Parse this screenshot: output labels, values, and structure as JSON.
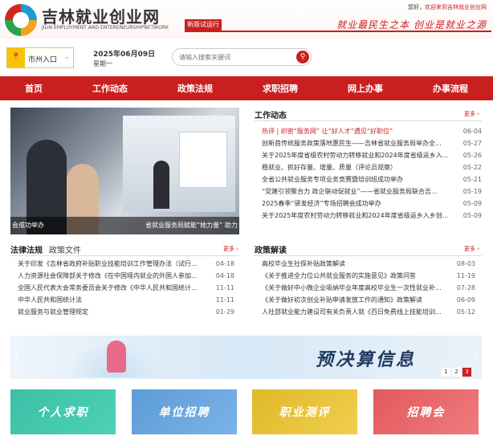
{
  "header": {
    "site_name": "吉林就业创业网",
    "site_name_en": "JILIN EMPLOYMENT AND ENTERENEURSHIPNETWORK",
    "badge": "新版试运行",
    "greeting_prefix": "您好，",
    "greeting_text": "欢迎来到吉林就业创业网",
    "slogan": "就业最民生之本  创业是就业之源"
  },
  "toolbar": {
    "city_label": "市州入口",
    "date": "2025年06月09日",
    "weekday": "星期一",
    "search_placeholder": "请输入搜索关键词"
  },
  "nav": [
    "首页",
    "工作动态",
    "政策法规",
    "求职招聘",
    "网上办事",
    "办事流程"
  ],
  "slider": {
    "caption_left": "会成功举办",
    "caption_right": "省就业服务局赋能“她力量” 助力"
  },
  "work_news": {
    "title": "工作动态",
    "more": "更多 ›",
    "items": [
      {
        "title": "热评 | 织密“服务网” 让“好人才”遇见“好职位”",
        "date": "06-04",
        "highlight": true
      },
      {
        "title": "创新首传统服务政策落地惠民生——吉林省就业服务局举办全...",
        "date": "05-27"
      },
      {
        "title": "关于2025年度省级农村劳动力转移就业和2024年度省级返乡入...",
        "date": "05-26"
      },
      {
        "title": "稳就业、抓好存量、增量、质量（评论员观察）",
        "date": "05-22"
      },
      {
        "title": "全省公共就业服务专项业务竞赛暨培训班成功举办",
        "date": "05-21"
      },
      {
        "title": "“党建引领聚合力 政企联动促就业”——省就业服务局联合吉...",
        "date": "05-19"
      },
      {
        "title": "2025春季“驿发经济”专场招聘会成功举办",
        "date": "05-09"
      },
      {
        "title": "关于2025年度农村劳动力转移就业和2024年度省级返乡入乡创...",
        "date": "05-09"
      }
    ]
  },
  "laws": {
    "tab_active": "法律法规",
    "tab_inactive": "政策文件",
    "more": "更多 ›",
    "items": [
      {
        "title": "关于印发《吉林省政府补贴职业技能培训工作管理办法（试行...",
        "date": "04-18"
      },
      {
        "title": "人力资源社会保障部关于修改《在中国境内就业的外国人参加...",
        "date": "04-18"
      },
      {
        "title": "全国人民代表大会常务委员会关于修改《中华人民共和国统计...",
        "date": "11-11"
      },
      {
        "title": "中华人民共和国统计法",
        "date": "11-11"
      },
      {
        "title": "就业服务与就业管理规定",
        "date": "01-29"
      }
    ]
  },
  "policy": {
    "title": "政策解读",
    "more": "更多 ›",
    "items": [
      {
        "title": "高校毕业生社保补贴政策解读",
        "date": "08-03"
      },
      {
        "title": "《关于推进全力位公共就业服务的实施意见》政策问答",
        "date": "11-19"
      },
      {
        "title": "《关于做好中小微企业吸纳毕业年度高校毕业生一次性就业补...",
        "date": "07-28"
      },
      {
        "title": "《关于做好初次创业补贴申请发放工作的通知》政策解读",
        "date": "06-09"
      },
      {
        "title": "人社部就业能力建设司有关负责人就《百日免费线上技能培训...",
        "date": "05-12"
      }
    ]
  },
  "banner": {
    "text": "预决算信息",
    "pages": [
      "1",
      "2",
      "3"
    ],
    "active_page": "3"
  },
  "cards": [
    {
      "label": "个人求职",
      "color": "#3cbfa6"
    },
    {
      "label": "单位招聘",
      "color": "#5d9cd8"
    },
    {
      "label": "职业测评",
      "color": "#e0b92a"
    },
    {
      "label": "招聘会",
      "color": "#e2595c"
    }
  ]
}
